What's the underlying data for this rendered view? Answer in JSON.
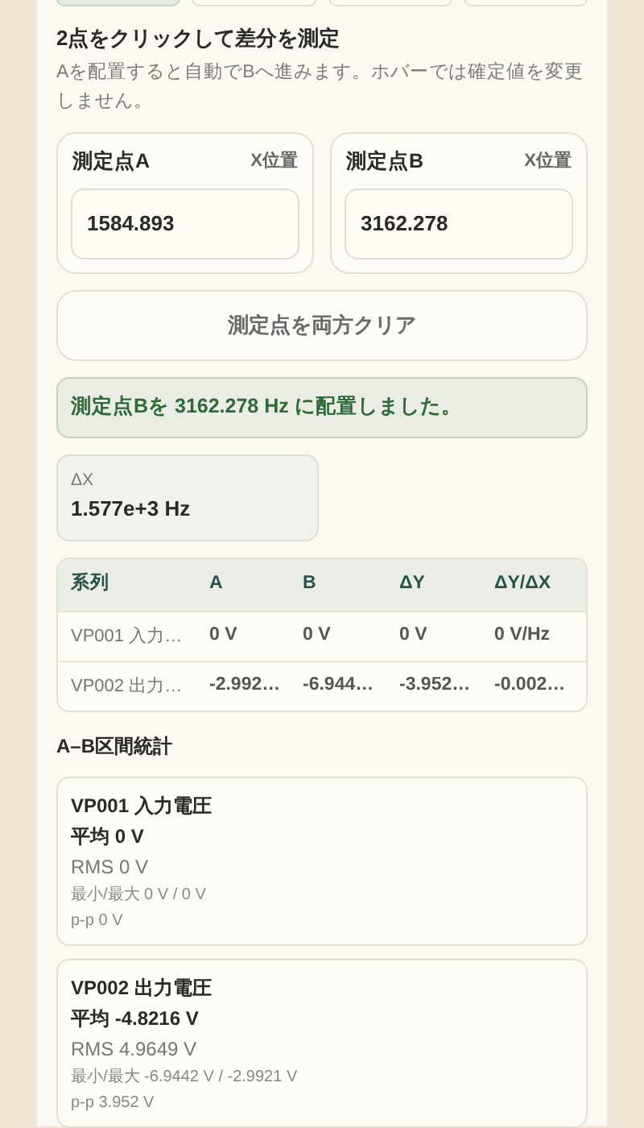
{
  "top_buttons": [
    {
      "selected": true
    },
    {
      "selected": false
    },
    {
      "selected": false
    },
    {
      "selected": false
    }
  ],
  "heading": "2点をクリックして差分を測定",
  "description": "Aを配置すると自動でBへ進みます。ホバーでは確定値を変更しません。",
  "points": [
    {
      "label": "測定点A",
      "axis": "X位置",
      "value": "1584.893"
    },
    {
      "label": "測定点B",
      "axis": "X位置",
      "value": "3162.278"
    }
  ],
  "clear_button": "測定点を両方クリア",
  "status_message": "測定点Bを 3162.278 Hz に配置しました。",
  "delta_x": {
    "label": "ΔX",
    "value": "1.577e+3 Hz"
  },
  "table": {
    "columns": [
      "系列",
      "A",
      "B",
      "ΔY",
      "ΔY/ΔX"
    ],
    "rows": [
      [
        "VP001 入力…",
        "0 V",
        "0 V",
        "0 V",
        "0 V/Hz"
      ],
      [
        "VP002 出力…",
        "-2.992…",
        "-6.944…",
        "-3.952…",
        "-0.002…"
      ]
    ]
  },
  "stats_title": "A–B区間統計",
  "stats": [
    {
      "name": "VP001 入力電圧",
      "mean": "平均 0 V",
      "rms": "RMS 0 V",
      "minmax": "最小/最大 0 V / 0 V",
      "pp": "p-p 0 V"
    },
    {
      "name": "VP002 出力電圧",
      "mean": "平均 -4.8216 V",
      "rms": "RMS 4.9649 V",
      "minmax": "最小/最大 -6.9442 V / -2.9921 V",
      "pp": "p-p 3.952 V"
    }
  ]
}
